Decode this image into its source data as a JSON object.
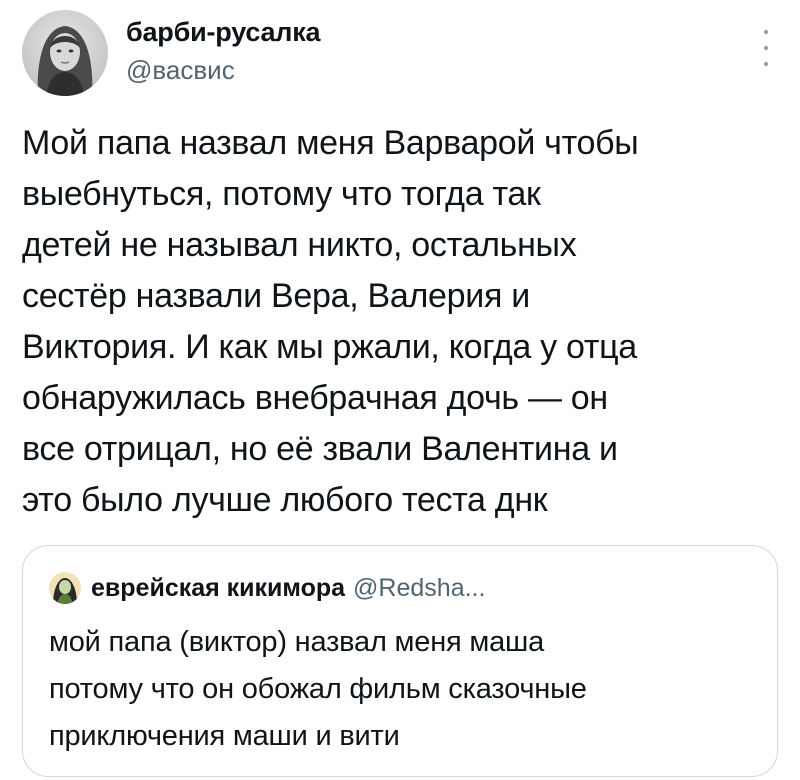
{
  "tweet": {
    "author": {
      "display_name": "барби-русалка",
      "handle": "@васвис",
      "avatar_icon": "user-avatar-photo"
    },
    "more_icon": "more-options-icon",
    "text_lines": [
      "Мой папа назвал меня Варварой чтобы",
      "выебнуться, потому что тогда так",
      "детей не называл никто, остальных",
      "сестёр назвали Вера, Валерия и",
      "Виктория. И как мы ржали, когда у отца",
      "обнаружилась внебрачная дочь — он",
      "все отрицал, но её звали Валентина и",
      "это было лучше любого теста днк"
    ]
  },
  "quoted_tweet": {
    "author": {
      "display_name": "еврейская кикимора",
      "handle": "@Redsha...",
      "avatar_icon": "user-avatar-photo"
    },
    "text_lines": [
      "мой папа (виктор) назвал меня маша",
      "потому что он обожал фильм сказочные",
      "приключения маши и вити"
    ]
  },
  "colors": {
    "text": "#0f1419",
    "secondary_text": "#536471",
    "border": "#cfd9de",
    "background": "#ffffff"
  }
}
